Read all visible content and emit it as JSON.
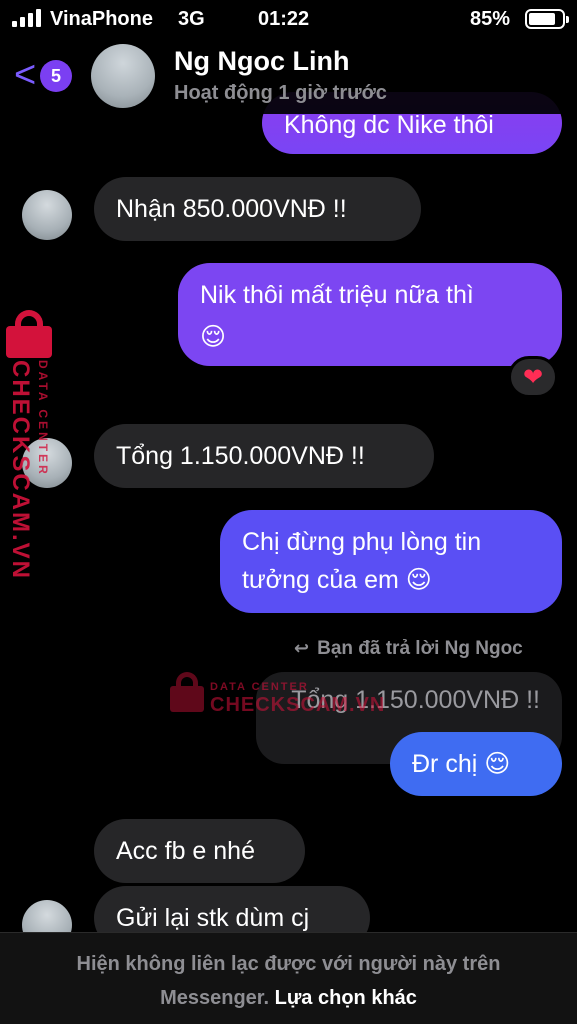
{
  "status_bar": {
    "carrier": "VinaPhone",
    "network": "3G",
    "time": "01:22",
    "battery": "85%"
  },
  "header": {
    "unread_count": "5",
    "contact_name": "Ng Ngoc Linh",
    "contact_status": "Hoạt động 1 giờ trước"
  },
  "messages": [
    {
      "text": "Không dc Nike thôi"
    },
    {
      "text": "Nhận 850.000VNĐ !!"
    },
    {
      "line1": "Nik thôi mất triệu nữa thì",
      "line2": "😌",
      "reaction": "❤"
    },
    {
      "text": "Tổng 1.150.000VNĐ !!"
    },
    {
      "line1": "Chị đừng phụ lòng tin",
      "line2": "tưởng của em 😌"
    },
    {
      "reply_label": "Bạn đã trả lời Ng Ngoc",
      "quoted": "Tổng 1.150.000VNĐ !!",
      "text": "Đr chị 😌"
    },
    {
      "text": "Acc fb e nhé"
    },
    {
      "text": "Gửi lại stk dùm cj"
    }
  ],
  "watermark": {
    "small": "DATA CENTER",
    "large": "CHECKSCAM.VN"
  },
  "footer": {
    "line1": "Hiện không liên lạc được với người này trên",
    "line2": "Messenger.",
    "action": "Lựa chọn khác"
  }
}
